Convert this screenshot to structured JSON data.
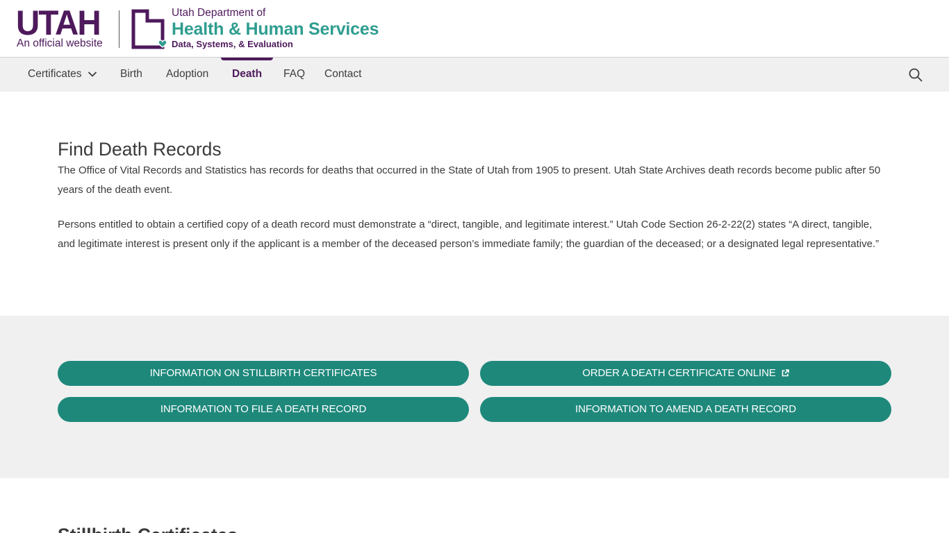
{
  "header": {
    "utah_wordmark": "UTAH",
    "official_tagline": "An official website",
    "dept_line1": "Utah Department of",
    "dept_line2": "Health & Human Services",
    "dept_line3": "Data, Systems, & Evaluation"
  },
  "nav": {
    "items": [
      {
        "label": "Certificates",
        "has_dropdown": true,
        "active": false
      },
      {
        "label": "Birth",
        "active": false
      },
      {
        "label": "Adoption",
        "active": false
      },
      {
        "label": "Death",
        "active": true
      },
      {
        "label": "FAQ",
        "active": false
      },
      {
        "label": "Contact",
        "active": false
      }
    ],
    "search_icon": "search-icon"
  },
  "main": {
    "title": "Find Death Records",
    "paragraph1": "The Office of Vital Records and Statistics has records for deaths that occurred in the State of Utah from 1905 to present. Utah State Archives death records become public after 50 years of the death event.",
    "paragraph2": "Persons entitled to obtain a certified copy of a death record must demonstrate a “direct, tangible, and legitimate interest.” Utah Code Section 26-2-22(2) states “A direct, tangible, and legitimate interest is present only if the applicant is a member of the deceased person’s immediate family; the guardian of the deceased; or a designated legal representative.”"
  },
  "actions": {
    "stillbirth_info": "INFORMATION ON STILLBIRTH CERTIFICATES",
    "order_online": "ORDER A DEATH CERTIFICATE ONLINE",
    "file_record": "INFORMATION TO FILE A DEATH RECORD",
    "amend_record": "INFORMATION TO AMEND A DEATH RECORD"
  },
  "next_section": {
    "heading": "Stillbirth Certificates"
  },
  "colors": {
    "brand_purple": "#4e1a5c",
    "brand_teal": "#2e9d8f",
    "button_teal": "#1e887b",
    "band_gray": "#f0f0f0"
  }
}
